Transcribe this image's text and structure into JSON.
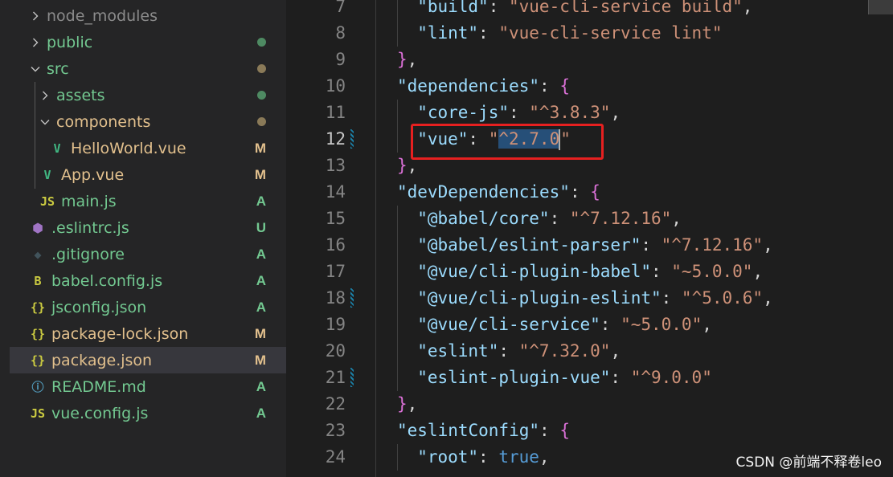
{
  "explorer": {
    "items": [
      {
        "label": "node_modules",
        "chev": "right",
        "icon": "none",
        "status": "",
        "color": "#8b8b8b"
      },
      {
        "label": "public",
        "chev": "right",
        "icon": "none",
        "status": "dot",
        "color": "#73c991"
      },
      {
        "label": "src",
        "chev": "down",
        "icon": "none",
        "status": "dot-muted",
        "color": "#73c991"
      },
      {
        "label": "assets",
        "chev": "right",
        "icon": "none",
        "status": "dot",
        "color": "#73c991"
      },
      {
        "label": "components",
        "chev": "down",
        "icon": "none",
        "status": "dot-muted",
        "color": "#e2c08d"
      },
      {
        "label": "HelloWorld.vue",
        "chev": "none",
        "icon": "V",
        "status": "M",
        "color": "#e2c08d"
      },
      {
        "label": "App.vue",
        "chev": "none",
        "icon": "V",
        "status": "M",
        "color": "#e2c08d"
      },
      {
        "label": "main.js",
        "chev": "none",
        "icon": "JS",
        "status": "A",
        "color": "#73c991"
      },
      {
        "label": ".eslintrc.js",
        "chev": "none",
        "icon": "⬢",
        "status": "U",
        "color": "#73c991"
      },
      {
        "label": ".gitignore",
        "chev": "none",
        "icon": "◆",
        "status": "A",
        "color": "#73c991"
      },
      {
        "label": "babel.config.js",
        "chev": "none",
        "icon": "B",
        "status": "A",
        "color": "#73c991"
      },
      {
        "label": "jsconfig.json",
        "chev": "none",
        "icon": "{}",
        "status": "A",
        "color": "#73c991"
      },
      {
        "label": "package-lock.json",
        "chev": "none",
        "icon": "{}",
        "status": "M",
        "color": "#e2c08d"
      },
      {
        "label": "package.json",
        "chev": "none",
        "icon": "{}",
        "status": "M",
        "color": "#e2c08d",
        "active": true
      },
      {
        "label": "README.md",
        "chev": "none",
        "icon": "ⓘ",
        "status": "A",
        "color": "#73c991"
      },
      {
        "label": "vue.config.js",
        "chev": "none",
        "icon": "JS",
        "status": "A",
        "color": "#73c991"
      }
    ]
  },
  "editor": {
    "current_line": 12,
    "lines": [
      {
        "n": "7",
        "tokens": [
          {
            "t": "\"build\"",
            "c": "key"
          },
          {
            "t": ": ",
            "c": "punct"
          },
          {
            "t": "\"vue-cli-service build\"",
            "c": "str"
          },
          {
            "t": ",",
            "c": "punct"
          }
        ],
        "indent": 2
      },
      {
        "n": "8",
        "tokens": [
          {
            "t": "\"lint\"",
            "c": "key"
          },
          {
            "t": ": ",
            "c": "punct"
          },
          {
            "t": "\"vue-cli-service lint\"",
            "c": "str"
          }
        ],
        "indent": 2
      },
      {
        "n": "9",
        "tokens": [
          {
            "t": "}",
            "c": "brace"
          },
          {
            "t": ",",
            "c": "punct"
          }
        ],
        "indent": 1
      },
      {
        "n": "10",
        "tokens": [
          {
            "t": "\"dependencies\"",
            "c": "key"
          },
          {
            "t": ": ",
            "c": "punct"
          },
          {
            "t": "{",
            "c": "brace"
          }
        ],
        "indent": 1
      },
      {
        "n": "11",
        "tokens": [
          {
            "t": "\"core-js\"",
            "c": "key"
          },
          {
            "t": ": ",
            "c": "punct"
          },
          {
            "t": "\"^3.8.3\"",
            "c": "str"
          },
          {
            "t": ",",
            "c": "punct"
          }
        ],
        "indent": 2
      },
      {
        "n": "12",
        "tokens": [
          {
            "t": "\"vue\"",
            "c": "key"
          },
          {
            "t": ": ",
            "c": "punct"
          },
          {
            "t": "\"",
            "c": "str"
          },
          {
            "t": "^2.7.0",
            "c": "str-sel"
          },
          {
            "t": "\"",
            "c": "str"
          }
        ],
        "indent": 2,
        "marker": true
      },
      {
        "n": "13",
        "tokens": [
          {
            "t": "}",
            "c": "brace"
          },
          {
            "t": ",",
            "c": "punct"
          }
        ],
        "indent": 1
      },
      {
        "n": "14",
        "tokens": [
          {
            "t": "\"devDependencies\"",
            "c": "key"
          },
          {
            "t": ": ",
            "c": "punct"
          },
          {
            "t": "{",
            "c": "brace"
          }
        ],
        "indent": 1
      },
      {
        "n": "15",
        "tokens": [
          {
            "t": "\"@babel/core\"",
            "c": "key"
          },
          {
            "t": ": ",
            "c": "punct"
          },
          {
            "t": "\"^7.12.16\"",
            "c": "str"
          },
          {
            "t": ",",
            "c": "punct"
          }
        ],
        "indent": 2
      },
      {
        "n": "16",
        "tokens": [
          {
            "t": "\"@babel/eslint-parser\"",
            "c": "key"
          },
          {
            "t": ": ",
            "c": "punct"
          },
          {
            "t": "\"^7.12.16\"",
            "c": "str"
          },
          {
            "t": ",",
            "c": "punct"
          }
        ],
        "indent": 2
      },
      {
        "n": "17",
        "tokens": [
          {
            "t": "\"@vue/cli-plugin-babel\"",
            "c": "key"
          },
          {
            "t": ": ",
            "c": "punct"
          },
          {
            "t": "\"~5.0.0\"",
            "c": "str"
          },
          {
            "t": ",",
            "c": "punct"
          }
        ],
        "indent": 2
      },
      {
        "n": "18",
        "tokens": [
          {
            "t": "\"@vue/cli-plugin-eslint\"",
            "c": "key"
          },
          {
            "t": ": ",
            "c": "punct"
          },
          {
            "t": "\"^5.0.6\"",
            "c": "str"
          },
          {
            "t": ",",
            "c": "punct"
          }
        ],
        "indent": 2,
        "marker": true
      },
      {
        "n": "19",
        "tokens": [
          {
            "t": "\"@vue/cli-service\"",
            "c": "key"
          },
          {
            "t": ": ",
            "c": "punct"
          },
          {
            "t": "\"~5.0.0\"",
            "c": "str"
          },
          {
            "t": ",",
            "c": "punct"
          }
        ],
        "indent": 2
      },
      {
        "n": "20",
        "tokens": [
          {
            "t": "\"eslint\"",
            "c": "key"
          },
          {
            "t": ": ",
            "c": "punct"
          },
          {
            "t": "\"^7.32.0\"",
            "c": "str"
          },
          {
            "t": ",",
            "c": "punct"
          }
        ],
        "indent": 2
      },
      {
        "n": "21",
        "tokens": [
          {
            "t": "\"eslint-plugin-vue\"",
            "c": "key"
          },
          {
            "t": ": ",
            "c": "punct"
          },
          {
            "t": "\"^9.0.0\"",
            "c": "str"
          }
        ],
        "indent": 2,
        "marker": true
      },
      {
        "n": "22",
        "tokens": [
          {
            "t": "}",
            "c": "brace"
          },
          {
            "t": ",",
            "c": "punct"
          }
        ],
        "indent": 1
      },
      {
        "n": "23",
        "tokens": [
          {
            "t": "\"eslintConfig\"",
            "c": "key"
          },
          {
            "t": ": ",
            "c": "punct"
          },
          {
            "t": "{",
            "c": "brace"
          }
        ],
        "indent": 1
      },
      {
        "n": "24",
        "tokens": [
          {
            "t": "\"root\"",
            "c": "key"
          },
          {
            "t": ": ",
            "c": "punct"
          },
          {
            "t": "true",
            "c": "kw"
          },
          {
            "t": ",",
            "c": "punct"
          }
        ],
        "indent": 2
      }
    ]
  },
  "colors": {
    "added": "#73c991",
    "modified": "#e2c08d",
    "highlight_box": "#e62020",
    "selection": "#264f78"
  },
  "watermark": "CSDN @前端不释卷leo"
}
